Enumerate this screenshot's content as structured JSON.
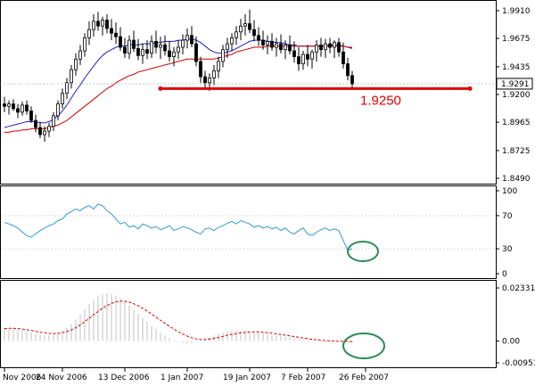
{
  "colors": {
    "candle_up": "#ffffff",
    "candle_outline": "#000000",
    "ma_fast": "#2020c0",
    "ma_slow": "#d00000",
    "support_line": "#e00000",
    "rsi_line": "#3399cc",
    "macd_hist": "#c0c0c0",
    "macd_signal": "#d00000",
    "annotation_circle": "#2e8b57",
    "price_box": "#ffffff"
  },
  "chart_data": [
    {
      "type": "candlestick",
      "panel": "price",
      "ylim": [
        1.849,
        1.926
      ],
      "y_ticks": [
        "1.9910",
        "1.9675",
        "1.9435",
        "1.9200",
        "1.8965",
        "1.8725",
        "1.8490"
      ],
      "y_tick_values": [
        1.991,
        1.9675,
        1.9435,
        1.92,
        1.8965,
        1.8725,
        1.849
      ],
      "current_price_label": "1.9291",
      "current_price": 1.9291,
      "support_label": "1.9250",
      "support_level": 1.925,
      "legend": "none",
      "grid": false,
      "series": [
        {
          "name": "",
          "kind": "ohlc",
          "values": [
            [
              1.912,
              1.918,
              1.905,
              1.91
            ],
            [
              1.91,
              1.915,
              1.903,
              1.912
            ],
            [
              1.912,
              1.916,
              1.906,
              1.908
            ],
            [
              1.908,
              1.912,
              1.9,
              1.905
            ],
            [
              1.905,
              1.914,
              1.902,
              1.911
            ],
            [
              1.911,
              1.915,
              1.903,
              1.906
            ],
            [
              1.906,
              1.91,
              1.896,
              1.898
            ],
            [
              1.898,
              1.903,
              1.888,
              1.892
            ],
            [
              1.892,
              1.897,
              1.883,
              1.886
            ],
            [
              1.886,
              1.893,
              1.88,
              1.889
            ],
            [
              1.889,
              1.896,
              1.884,
              1.893
            ],
            [
              1.893,
              1.905,
              1.889,
              1.902
            ],
            [
              1.902,
              1.915,
              1.898,
              1.912
            ],
            [
              1.912,
              1.925,
              1.908,
              1.921
            ],
            [
              1.921,
              1.934,
              1.916,
              1.93
            ],
            [
              1.93,
              1.945,
              1.925,
              1.941
            ],
            [
              1.941,
              1.955,
              1.936,
              1.95
            ],
            [
              1.95,
              1.962,
              1.945,
              1.957
            ],
            [
              1.957,
              1.972,
              1.952,
              1.968
            ],
            [
              1.968,
              1.982,
              1.962,
              1.975
            ],
            [
              1.975,
              1.988,
              1.969,
              1.982
            ],
            [
              1.982,
              1.99,
              1.974,
              1.978
            ],
            [
              1.978,
              1.986,
              1.97,
              1.983
            ],
            [
              1.983,
              1.988,
              1.972,
              1.976
            ],
            [
              1.976,
              1.984,
              1.966,
              1.972
            ],
            [
              1.972,
              1.981,
              1.963,
              1.969
            ],
            [
              1.969,
              1.977,
              1.957,
              1.96
            ],
            [
              1.96,
              1.968,
              1.951,
              1.955
            ],
            [
              1.955,
              1.97,
              1.95,
              1.966
            ],
            [
              1.966,
              1.974,
              1.956,
              1.959
            ],
            [
              1.959,
              1.967,
              1.949,
              1.953
            ],
            [
              1.953,
              1.963,
              1.946,
              1.958
            ],
            [
              1.958,
              1.966,
              1.95,
              1.955
            ],
            [
              1.955,
              1.97,
              1.951,
              1.965
            ],
            [
              1.965,
              1.974,
              1.955,
              1.96
            ],
            [
              1.96,
              1.969,
              1.95,
              1.962
            ],
            [
              1.962,
              1.97,
              1.953,
              1.957
            ],
            [
              1.957,
              1.965,
              1.948,
              1.952
            ],
            [
              1.952,
              1.96,
              1.944,
              1.956
            ],
            [
              1.956,
              1.966,
              1.95,
              1.96
            ],
            [
              1.96,
              1.971,
              1.954,
              1.966
            ],
            [
              1.966,
              1.976,
              1.959,
              1.97
            ],
            [
              1.97,
              1.978,
              1.96,
              1.963
            ],
            [
              1.963,
              1.969,
              1.944,
              1.948
            ],
            [
              1.948,
              1.952,
              1.93,
              1.935
            ],
            [
              1.935,
              1.94,
              1.924,
              1.93
            ],
            [
              1.93,
              1.938,
              1.923,
              1.934
            ],
            [
              1.934,
              1.945,
              1.928,
              1.94
            ],
            [
              1.94,
              1.952,
              1.934,
              1.948
            ],
            [
              1.948,
              1.962,
              1.943,
              1.958
            ],
            [
              1.958,
              1.968,
              1.951,
              1.963
            ],
            [
              1.963,
              1.972,
              1.957,
              1.968
            ],
            [
              1.968,
              1.978,
              1.962,
              1.973
            ],
            [
              1.973,
              1.984,
              1.966,
              1.978
            ],
            [
              1.978,
              1.988,
              1.97,
              1.98
            ],
            [
              1.98,
              1.992,
              1.972,
              1.975
            ],
            [
              1.975,
              1.983,
              1.965,
              1.97
            ],
            [
              1.97,
              1.977,
              1.961,
              1.966
            ],
            [
              1.966,
              1.974,
              1.958,
              1.962
            ],
            [
              1.962,
              1.97,
              1.954,
              1.965
            ],
            [
              1.965,
              1.972,
              1.957,
              1.96
            ],
            [
              1.96,
              1.968,
              1.952,
              1.963
            ],
            [
              1.963,
              1.971,
              1.955,
              1.958
            ],
            [
              1.958,
              1.966,
              1.95,
              1.962
            ],
            [
              1.962,
              1.97,
              1.954,
              1.957
            ],
            [
              1.957,
              1.965,
              1.947,
              1.952
            ],
            [
              1.952,
              1.96,
              1.94,
              1.946
            ],
            [
              1.946,
              1.957,
              1.941,
              1.954
            ],
            [
              1.954,
              1.962,
              1.944,
              1.95
            ],
            [
              1.95,
              1.958,
              1.942,
              1.956
            ],
            [
              1.956,
              1.966,
              1.948,
              1.962
            ],
            [
              1.962,
              1.968,
              1.952,
              1.958
            ],
            [
              1.958,
              1.967,
              1.951,
              1.963
            ],
            [
              1.963,
              1.968,
              1.955,
              1.96
            ],
            [
              1.96,
              1.966,
              1.951,
              1.964
            ],
            [
              1.964,
              1.968,
              1.952,
              1.956
            ],
            [
              1.956,
              1.964,
              1.942,
              1.946
            ],
            [
              1.946,
              1.951,
              1.932,
              1.936
            ],
            [
              1.936,
              1.94,
              1.926,
              1.929
            ]
          ]
        },
        {
          "name": "",
          "kind": "ma_fast",
          "values": [
            1.892,
            1.893,
            1.894,
            1.895,
            1.896,
            1.897,
            1.897,
            1.897,
            1.896,
            1.896,
            1.897,
            1.899,
            1.902,
            1.906,
            1.911,
            1.917,
            1.923,
            1.928,
            1.934,
            1.939,
            1.944,
            1.949,
            1.953,
            1.956,
            1.958,
            1.96,
            1.961,
            1.961,
            1.962,
            1.962,
            1.962,
            1.963,
            1.963,
            1.963,
            1.964,
            1.964,
            1.965,
            1.965,
            1.965,
            1.966,
            1.966,
            1.967,
            1.967,
            1.966,
            1.964,
            1.961,
            1.958,
            1.956,
            1.955,
            1.955,
            1.956,
            1.957,
            1.959,
            1.961,
            1.963,
            1.965,
            1.966,
            1.966,
            1.966,
            1.965,
            1.965,
            1.964,
            1.964,
            1.963,
            1.962,
            1.962,
            1.961,
            1.961,
            1.961,
            1.961,
            1.961,
            1.961,
            1.961,
            1.962,
            1.962,
            1.962,
            1.961,
            1.96,
            1.959
          ]
        },
        {
          "name": "",
          "kind": "ma_slow",
          "values": [
            1.888,
            1.888,
            1.889,
            1.889,
            1.89,
            1.89,
            1.891,
            1.891,
            1.891,
            1.891,
            1.892,
            1.893,
            1.894,
            1.896,
            1.898,
            1.901,
            1.904,
            1.907,
            1.91,
            1.913,
            1.916,
            1.919,
            1.922,
            1.925,
            1.927,
            1.93,
            1.932,
            1.934,
            1.936,
            1.937,
            1.939,
            1.94,
            1.941,
            1.942,
            1.943,
            1.944,
            1.945,
            1.946,
            1.947,
            1.948,
            1.949,
            1.95,
            1.95,
            1.95,
            1.95,
            1.95,
            1.95,
            1.95,
            1.951,
            1.952,
            1.953,
            1.954,
            1.956,
            1.957,
            1.958,
            1.959,
            1.96,
            1.96,
            1.96,
            1.961,
            1.961,
            1.961,
            1.961,
            1.961,
            1.961,
            1.961,
            1.961,
            1.961,
            1.961,
            1.961,
            1.961,
            1.961,
            1.961,
            1.961,
            1.961,
            1.961,
            1.961,
            1.96,
            1.96
          ]
        }
      ]
    },
    {
      "type": "line",
      "panel": "oscillator",
      "ylim": [
        0,
        100
      ],
      "y_ticks": [
        "100",
        "70",
        "30",
        "0"
      ],
      "y_tick_values": [
        100,
        70,
        30,
        0
      ],
      "legend": "none",
      "series": [
        {
          "name": "",
          "kind": "rsi",
          "values": [
            62,
            60,
            58,
            55,
            50,
            46,
            44,
            48,
            52,
            55,
            58,
            60,
            64,
            66,
            72,
            75,
            78,
            76,
            80,
            82,
            78,
            84,
            82,
            76,
            72,
            66,
            60,
            62,
            56,
            58,
            54,
            60,
            58,
            55,
            57,
            53,
            55,
            58,
            52,
            54,
            57,
            55,
            53,
            50,
            48,
            54,
            55,
            52,
            56,
            58,
            61,
            63,
            60,
            64,
            62,
            60,
            56,
            58,
            55,
            57,
            54,
            56,
            52,
            55,
            50,
            48,
            52,
            55,
            48,
            46,
            50,
            53,
            55,
            52,
            54,
            52,
            40,
            28,
            30
          ]
        }
      ]
    },
    {
      "type": "bar",
      "panel": "histogram",
      "ylim": [
        -0.00951,
        0.02331
      ],
      "y_ticks": [
        "0.02331",
        "0.00",
        "-0.00951"
      ],
      "y_tick_values": [
        0.02331,
        0.0,
        -0.00951
      ],
      "legend": "none",
      "series": [
        {
          "name": "",
          "kind": "histogram",
          "values": [
            0.006,
            0.0058,
            0.0055,
            0.0052,
            0.0048,
            0.0042,
            0.0036,
            0.0031,
            0.0027,
            0.0025,
            0.0026,
            0.0029,
            0.0035,
            0.0045,
            0.0058,
            0.0075,
            0.0095,
            0.0118,
            0.014,
            0.0162,
            0.018,
            0.0195,
            0.0205,
            0.021,
            0.0207,
            0.02,
            0.0188,
            0.0172,
            0.0155,
            0.0138,
            0.012,
            0.0102,
            0.0085,
            0.0068,
            0.0052,
            0.0038,
            0.0025,
            0.0014,
            0.0005,
            -0.0003,
            -0.0009,
            -0.001,
            -0.0008,
            -0.0004,
            0.0002,
            0.0009,
            0.0017,
            0.0025,
            0.0033,
            0.0038,
            0.0042,
            0.0045,
            0.0046,
            0.0046,
            0.0045,
            0.0043,
            0.004,
            0.0037,
            0.0034,
            0.0031,
            0.0028,
            0.0025,
            0.0022,
            0.0019,
            0.0016,
            0.0013,
            0.001,
            0.0007,
            0.0004,
            0.0002,
            0.0001,
            0.0,
            -0.0001,
            0.0,
            0.0001,
            0.0001,
            0.0,
            -0.0002,
            -0.0004
          ]
        },
        {
          "name": "",
          "kind": "signal",
          "values": [
            0.0055,
            0.0056,
            0.0056,
            0.0055,
            0.0053,
            0.005,
            0.0047,
            0.0043,
            0.0039,
            0.0036,
            0.0034,
            0.0033,
            0.0034,
            0.0037,
            0.0042,
            0.0049,
            0.0059,
            0.0071,
            0.0085,
            0.01,
            0.0115,
            0.013,
            0.0144,
            0.0156,
            0.0165,
            0.0172,
            0.0175,
            0.0175,
            0.0171,
            0.0164,
            0.0155,
            0.0144,
            0.0132,
            0.0119,
            0.0105,
            0.0091,
            0.0078,
            0.0065,
            0.0053,
            0.0041,
            0.0031,
            0.0022,
            0.0015,
            0.001,
            0.0007,
            0.0007,
            0.0009,
            0.0012,
            0.0016,
            0.0021,
            0.0026,
            0.003,
            0.0033,
            0.0036,
            0.0038,
            0.004,
            0.0041,
            0.004,
            0.0039,
            0.0037,
            0.0035,
            0.0032,
            0.0029,
            0.0026,
            0.0023,
            0.002,
            0.0017,
            0.0014,
            0.0011,
            0.0008,
            0.0006,
            0.0004,
            0.0002,
            0.0001,
            0.0,
            -0.0001,
            -0.0001,
            -0.0001,
            -0.0002
          ]
        }
      ]
    }
  ],
  "x_axis": {
    "labels": [
      "Nov 2006",
      "24 Nov 2006",
      "13 Dec 2006",
      "1 Jan 2007",
      "19 Jan 2007",
      "7 Feb 2007",
      "26 Feb 2007"
    ],
    "label_bars": [
      0,
      13,
      27,
      41,
      55,
      68,
      81
    ]
  }
}
